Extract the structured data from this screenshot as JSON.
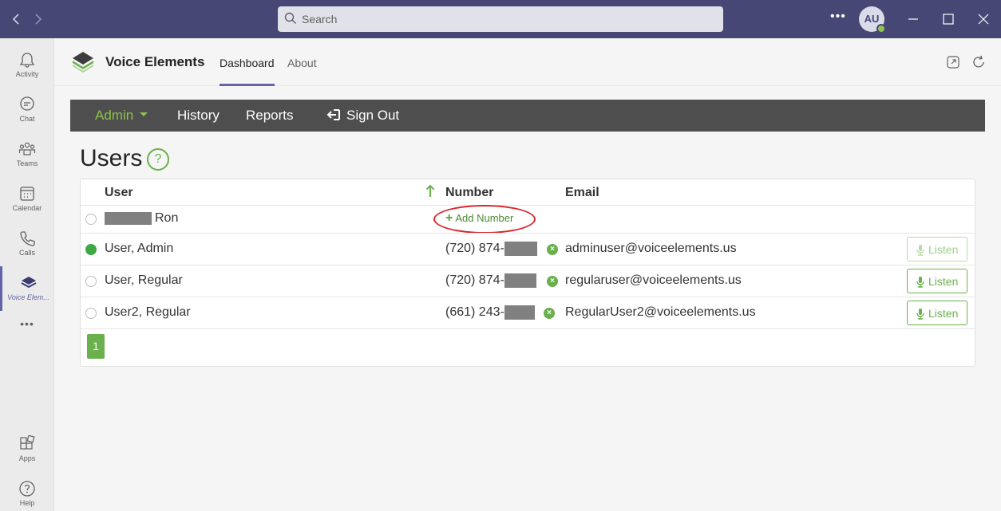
{
  "titlebar": {
    "search_placeholder": "Search",
    "more_label": "•••",
    "avatar_initials": "AU"
  },
  "rail": {
    "items": [
      {
        "label": "Activity",
        "icon": "bell-icon"
      },
      {
        "label": "Chat",
        "icon": "chat-icon"
      },
      {
        "label": "Teams",
        "icon": "teams-icon"
      },
      {
        "label": "Calendar",
        "icon": "calendar-icon"
      },
      {
        "label": "Calls",
        "icon": "phone-icon"
      },
      {
        "label": "Voice Elem...",
        "icon": "voice-elements-icon"
      },
      {
        "label": "Apps",
        "icon": "apps-icon"
      },
      {
        "label": "Help",
        "icon": "help-icon"
      }
    ],
    "more_label": "•••"
  },
  "app": {
    "name": "Voice Elements",
    "tabs": [
      {
        "label": "Dashboard",
        "active": true
      },
      {
        "label": "About",
        "active": false
      }
    ]
  },
  "navbar": {
    "admin": "Admin",
    "history": "History",
    "reports": "Reports",
    "sign_out": "Sign Out"
  },
  "page": {
    "title": "Users",
    "help": "?"
  },
  "table": {
    "headers": {
      "user": "User",
      "number": "Number",
      "email": "Email"
    },
    "add_number_label": "Add Number",
    "rows": [
      {
        "name": "Ron",
        "selected": false,
        "number": "",
        "email": "",
        "listen": null
      },
      {
        "name": "User, Admin",
        "selected": true,
        "number": "(720) 874-",
        "email": "adminuser@voiceelements.us",
        "listen": "Listen"
      },
      {
        "name": "User, Regular",
        "selected": false,
        "number": "(720) 874-",
        "email": "regularuser@voiceelements.us",
        "listen": "Listen"
      },
      {
        "name": "User2, Regular",
        "selected": false,
        "number": "(661) 243-",
        "email": "RegularUser2@voiceelements.us",
        "listen": "Listen"
      }
    ],
    "page_number": "1"
  },
  "colors": {
    "teams_purple": "#464775",
    "accent_green": "#6ab04c",
    "navbar_bg": "#4e4e4e",
    "highlight_red": "#d9252a"
  }
}
